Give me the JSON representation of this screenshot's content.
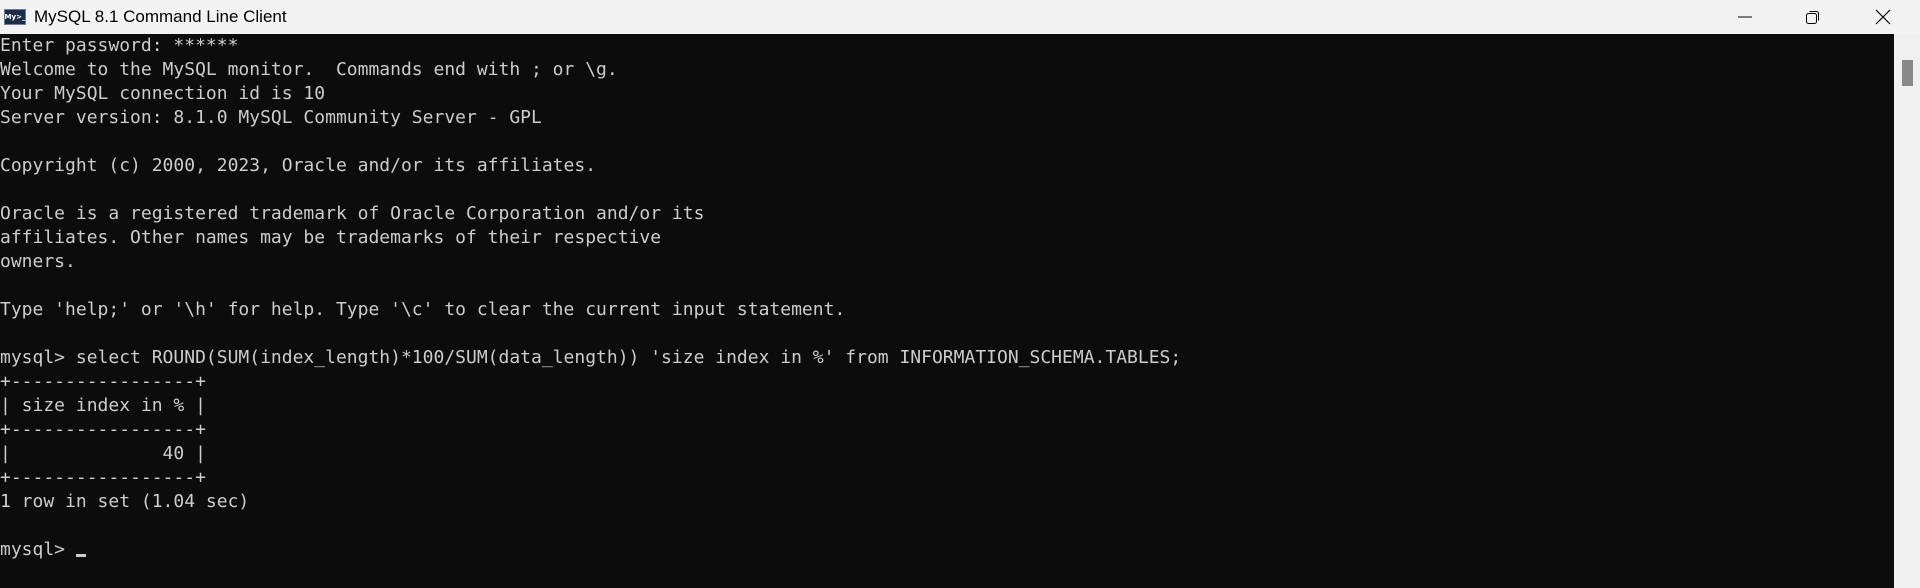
{
  "window": {
    "title": "MySQL 8.1 Command Line Client",
    "icon": "mysql-app-icon",
    "icon_text": "My>_",
    "controls": [
      "minimize-icon",
      "restore-icon",
      "close-icon"
    ]
  },
  "terminal": {
    "lines": [
      "Enter password: ******",
      "Welcome to the MySQL monitor.  Commands end with ; or \\g.",
      "Your MySQL connection id is 10",
      "Server version: 8.1.0 MySQL Community Server - GPL",
      "",
      "Copyright (c) 2000, 2023, Oracle and/or its affiliates.",
      "",
      "Oracle is a registered trademark of Oracle Corporation and/or its",
      "affiliates. Other names may be trademarks of their respective",
      "owners.",
      "",
      "Type 'help;' or '\\h' for help. Type '\\c' to clear the current input statement.",
      "",
      "mysql> select ROUND(SUM(index_length)*100/SUM(data_length)) 'size index in %' from INFORMATION_SCHEMA.TABLES;",
      "+-----------------+",
      "| size index in % |",
      "+-----------------+",
      "|              40 |",
      "+-----------------+",
      "1 row in set (1.04 sec)",
      ""
    ],
    "prompt": "mysql> ",
    "colors": {
      "background": "#0c0c0c",
      "text": "#cccccc"
    }
  }
}
